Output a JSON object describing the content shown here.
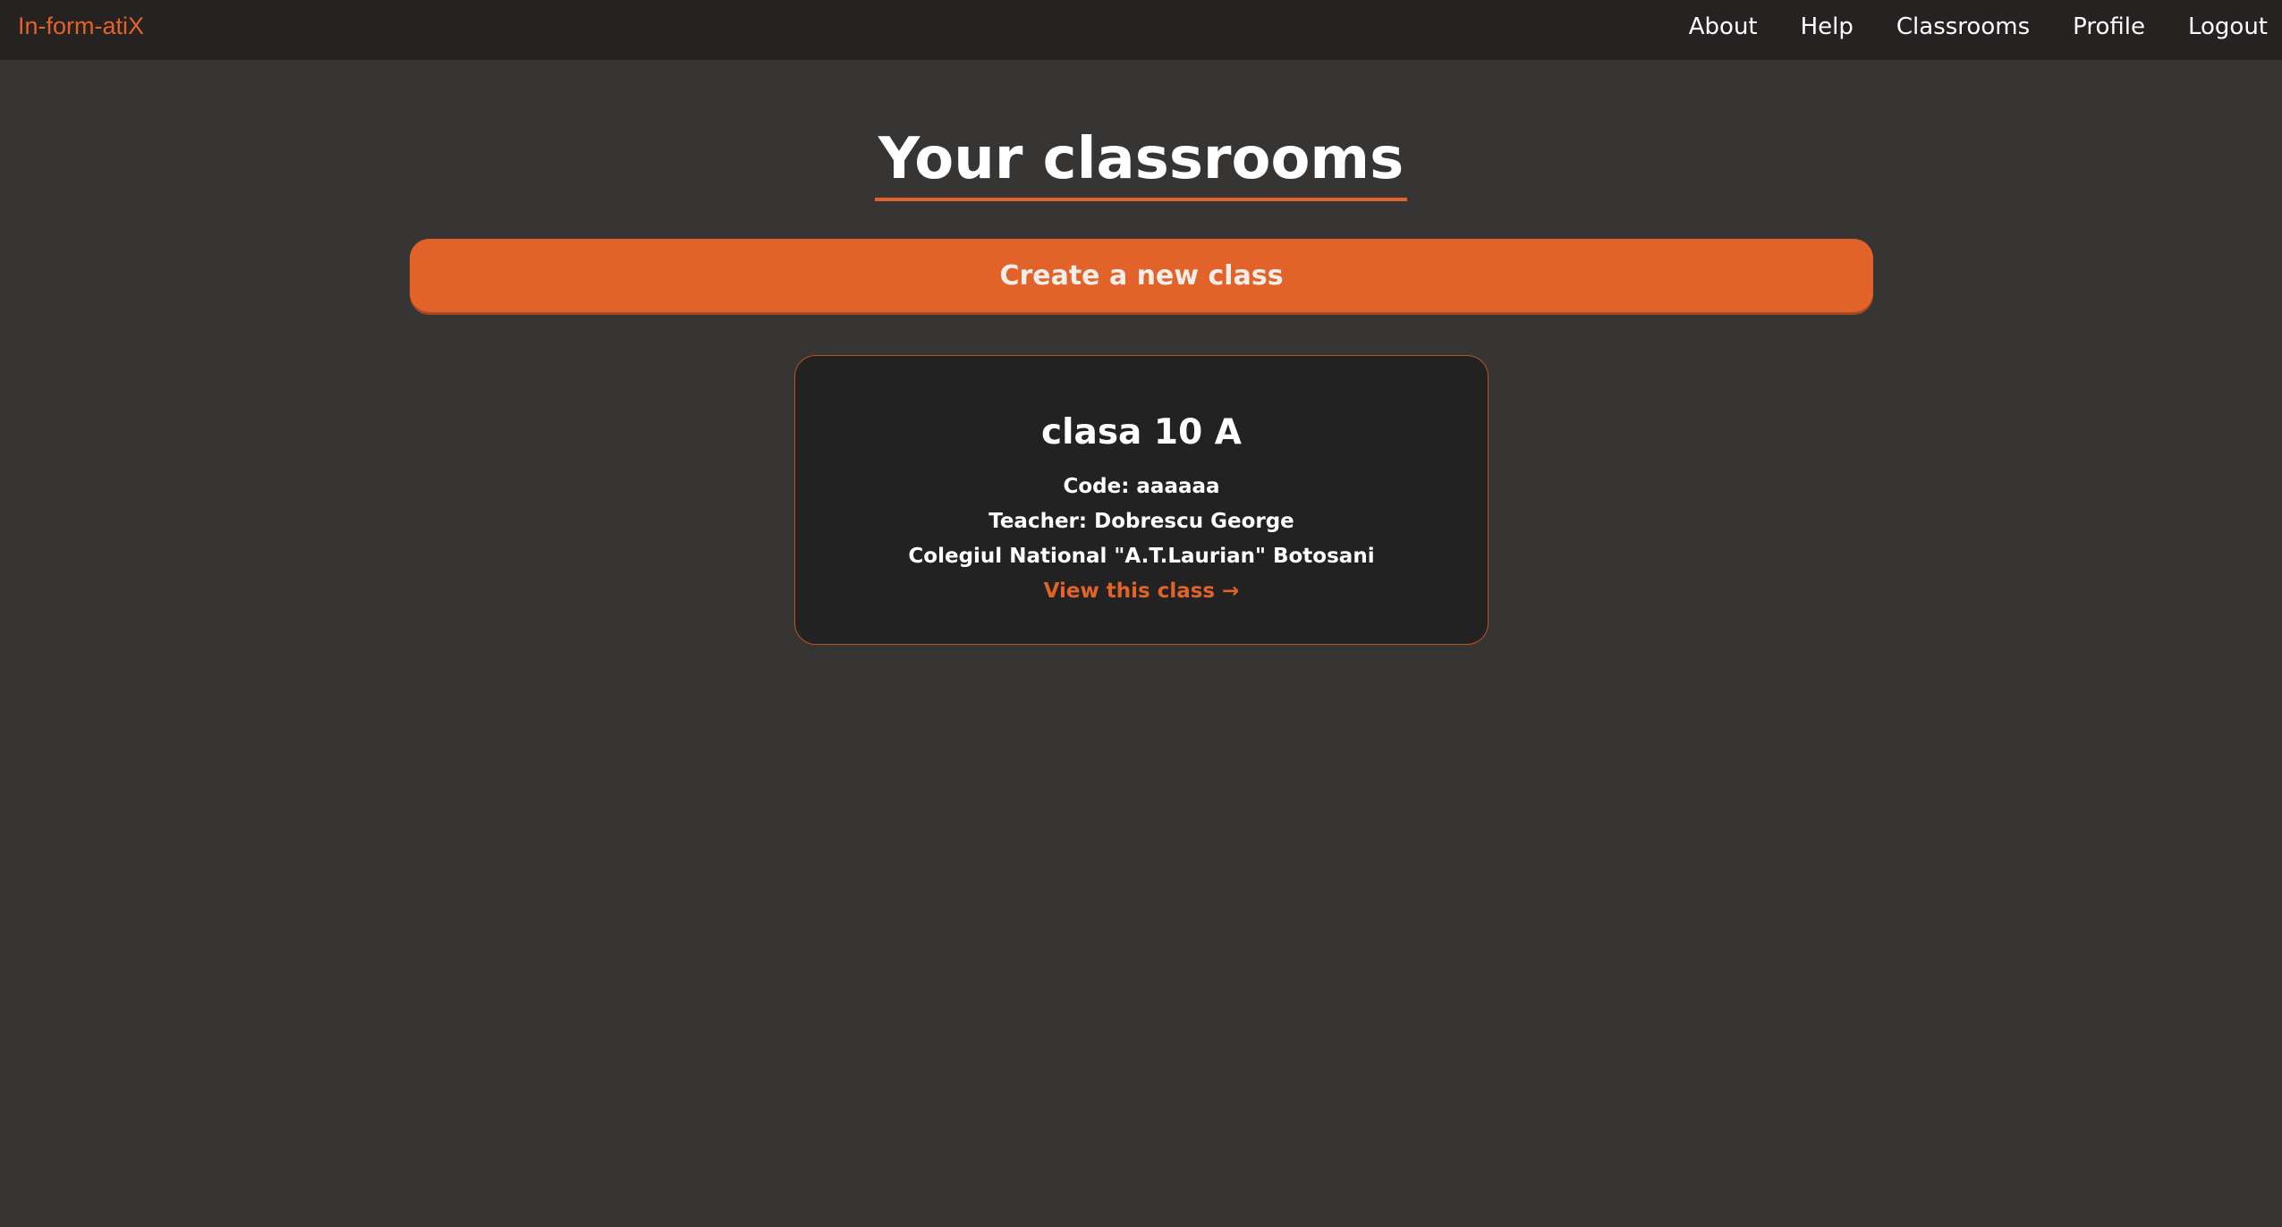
{
  "navbar": {
    "brand": "In-form-atiX",
    "links": [
      {
        "label": "About"
      },
      {
        "label": "Help"
      },
      {
        "label": "Classrooms"
      },
      {
        "label": "Profile"
      },
      {
        "label": "Logout"
      }
    ]
  },
  "main": {
    "title": "Your classrooms",
    "create_button_label": "Create a new class",
    "classrooms": [
      {
        "name": "clasa 10 A",
        "code": "Code: aaaaaa",
        "teacher": "Teacher: Dobrescu George",
        "school": "Colegiul National \"A.T.Laurian\" Botosani",
        "link_label": "View this class →"
      }
    ]
  },
  "colors": {
    "accent": "#e2632a",
    "background": "#363534",
    "navbar": "#262222",
    "card": "#222222"
  }
}
